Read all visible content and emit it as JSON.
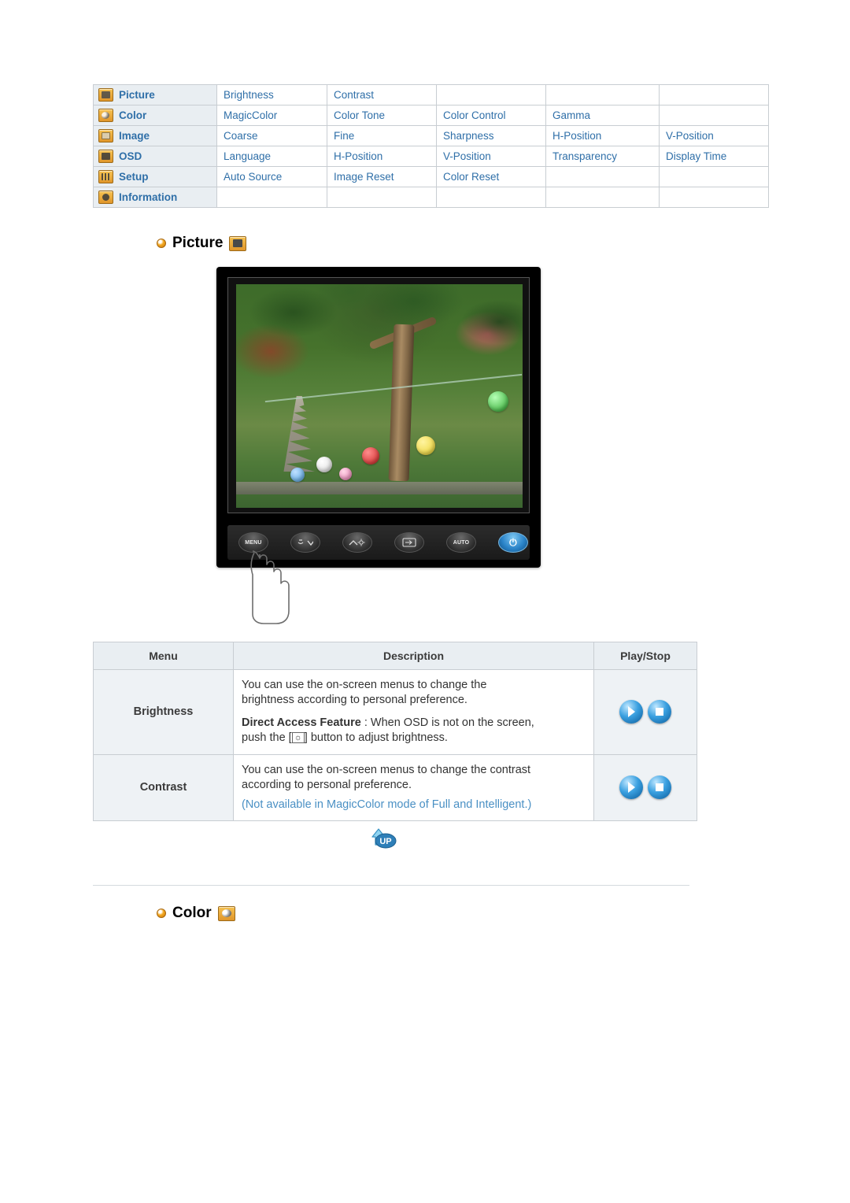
{
  "menu_matrix": {
    "rows": [
      {
        "category": "Picture",
        "icon": "picture-icon",
        "items": [
          "Brightness",
          "Contrast",
          "",
          "",
          ""
        ]
      },
      {
        "category": "Color",
        "icon": "color-icon",
        "items": [
          "MagicColor",
          "Color Tone",
          "Color Control",
          "Gamma",
          ""
        ]
      },
      {
        "category": "Image",
        "icon": "image-icon",
        "items": [
          "Coarse",
          "Fine",
          "Sharpness",
          "H-Position",
          "V-Position"
        ]
      },
      {
        "category": "OSD",
        "icon": "osd-icon",
        "items": [
          "Language",
          "H-Position",
          "V-Position",
          "Transparency",
          "Display Time"
        ]
      },
      {
        "category": "Setup",
        "icon": "setup-icon",
        "items": [
          "Auto Source",
          "Image Reset",
          "Color Reset",
          "",
          ""
        ]
      },
      {
        "category": "Information",
        "icon": "information-icon",
        "items": [
          "",
          "",
          "",
          "",
          ""
        ]
      }
    ]
  },
  "sections": {
    "picture_heading": "Picture",
    "color_heading": "Color"
  },
  "monitor": {
    "buttons": [
      {
        "name": "menu-button",
        "label": "MENU"
      },
      {
        "name": "down-button",
        "label": ""
      },
      {
        "name": "up-brightness-button",
        "label": ""
      },
      {
        "name": "enter-button",
        "label": ""
      },
      {
        "name": "auto-button",
        "label": "AUTO"
      },
      {
        "name": "power-button",
        "label": "⏻"
      }
    ]
  },
  "desc_table": {
    "headers": [
      "Menu",
      "Description",
      "Play/Stop"
    ],
    "rows": [
      {
        "menu": "Brightness",
        "lines": [
          "You can use the on-screen menus to change the",
          "brightness according to personal preference."
        ],
        "direct_label": "Direct Access Feature",
        "direct_text_1": " : When OSD is not on the screen,",
        "direct_text_2": "push the [",
        "direct_glyph": "☼",
        "direct_text_3": "] button to adjust brightness.",
        "note": "",
        "play_label": "play-icon",
        "stop_label": "stop-icon"
      },
      {
        "menu": "Contrast",
        "lines": [
          "You can use the on-screen menus to change the contrast",
          "according to personal preference."
        ],
        "note": "(Not available in MagicColor mode of Full and Intelligent.)",
        "play_label": "play-icon",
        "stop_label": "stop-icon"
      }
    ]
  },
  "up_button": {
    "label": "UP"
  },
  "colors": {
    "link_blue": "#2f6fa8",
    "note_blue": "#4a90c4",
    "header_bg": "#e9eef2",
    "border": "#c8cdd2"
  }
}
